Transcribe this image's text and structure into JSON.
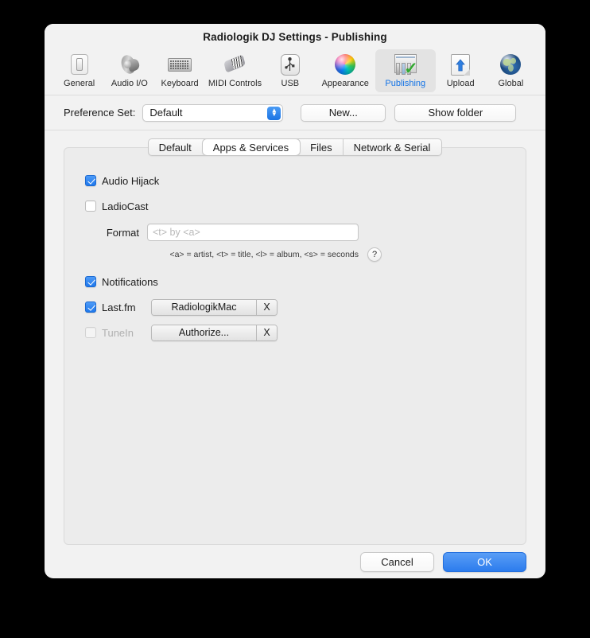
{
  "window": {
    "title": "Radiologik DJ Settings - Publishing"
  },
  "toolbar": {
    "items": [
      {
        "label": "General",
        "icon": "toggle-switch-icon",
        "selected": false
      },
      {
        "label": "Audio I/O",
        "icon": "speaker-icon",
        "selected": false
      },
      {
        "label": "Keyboard",
        "icon": "keyboard-icon",
        "selected": false
      },
      {
        "label": "MIDI Controls",
        "icon": "midi-controller-icon",
        "selected": false
      },
      {
        "label": "USB",
        "icon": "usb-icon",
        "selected": false
      },
      {
        "label": "Appearance",
        "icon": "color-wheel-icon",
        "selected": false
      },
      {
        "label": "Publishing",
        "icon": "publishing-icon",
        "selected": true
      },
      {
        "label": "Upload",
        "icon": "upload-arrow-icon",
        "selected": false
      },
      {
        "label": "Global",
        "icon": "globe-icon",
        "selected": false
      }
    ],
    "selected_color": "#1373e6"
  },
  "preference_set": {
    "label": "Preference Set:",
    "value": "Default",
    "new_button": "New...",
    "show_folder_button": "Show folder"
  },
  "tabs": {
    "items": [
      {
        "label": "Default",
        "selected": false
      },
      {
        "label": "Apps & Services",
        "selected": true
      },
      {
        "label": "Files",
        "selected": false
      },
      {
        "label": "Network & Serial",
        "selected": false
      }
    ]
  },
  "form": {
    "audio_hijack": {
      "label": "Audio Hijack",
      "checked": true
    },
    "ladiocast": {
      "label": "LadioCast",
      "checked": false
    },
    "format": {
      "label": "Format",
      "value": "",
      "placeholder": "<t> by <a>",
      "hint": "<a> = artist, <t> = title, <l> = album, <s> = seconds",
      "help_glyph": "?"
    },
    "notifications": {
      "label": "Notifications",
      "checked": true
    },
    "lastfm": {
      "label": "Last.fm",
      "checked": true,
      "account_button": "RadiologikMac",
      "clear_button": "X",
      "disabled": false
    },
    "tunein": {
      "label": "TuneIn",
      "checked": false,
      "account_button": "Authorize...",
      "clear_button": "X",
      "disabled": true
    }
  },
  "footer": {
    "cancel": "Cancel",
    "ok": "OK",
    "ok_color": "#2c7ced"
  }
}
